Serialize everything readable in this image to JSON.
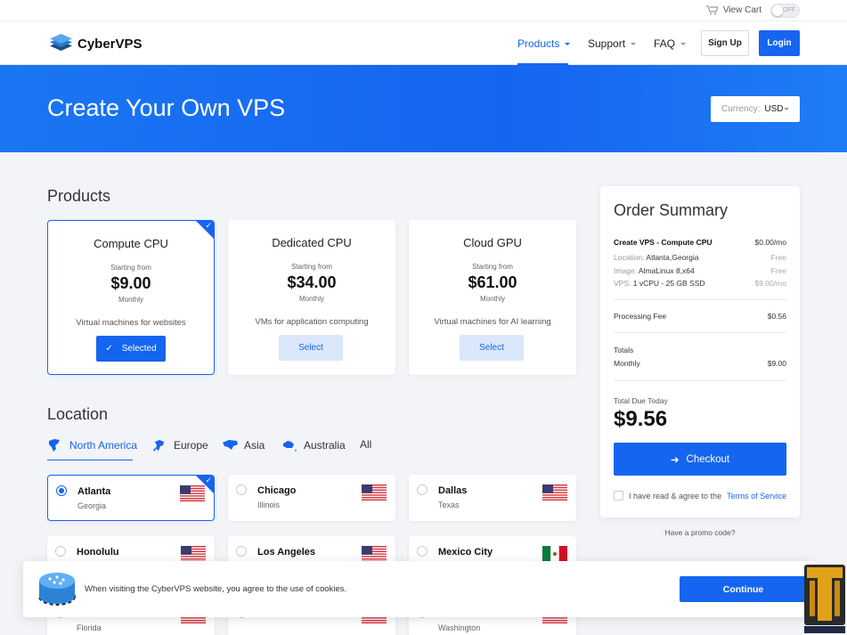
{
  "topbar": {
    "cart_label": "View Cart",
    "toggle_label": "OFF"
  },
  "nav": {
    "brand": "CyberVPS",
    "items": [
      {
        "label": "Products",
        "active": true
      },
      {
        "label": "Support",
        "active": false
      },
      {
        "label": "FAQ",
        "active": false
      }
    ],
    "signup_label": "Sign Up",
    "login_label": "Login"
  },
  "hero": {
    "title": "Create Your Own VPS",
    "currency_label": "Currency:",
    "currency_value": "USD"
  },
  "products": {
    "title": "Products",
    "cards": [
      {
        "name": "Compute CPU",
        "from": "Starting from",
        "price": "$9.00",
        "period": "Monthly",
        "desc": "Virtual machines for websites",
        "button": "Selected",
        "selected": true
      },
      {
        "name": "Dedicated CPU",
        "from": "Starting from",
        "price": "$34.00",
        "period": "Monthly",
        "desc": "VMs for application computing",
        "button": "Select",
        "selected": false
      },
      {
        "name": "Cloud GPU",
        "from": "Starting from",
        "price": "$61.00",
        "period": "Monthly",
        "desc": "Virtual machines for AI learning",
        "button": "Select",
        "selected": false
      }
    ]
  },
  "location": {
    "title": "Location",
    "tabs": [
      {
        "label": "North America",
        "icon": "north-america-icon",
        "active": true
      },
      {
        "label": "Europe",
        "icon": "europe-icon",
        "active": false
      },
      {
        "label": "Asia",
        "icon": "asia-icon",
        "active": false
      },
      {
        "label": "Australia",
        "icon": "australia-icon",
        "active": false
      },
      {
        "label": "All",
        "active": false
      }
    ],
    "cards": [
      {
        "city": "Atlanta",
        "state": "Georgia",
        "flag": "us-flag-icon",
        "selected": true
      },
      {
        "city": "Chicago",
        "state": "Illinois",
        "flag": "us-flag-icon",
        "selected": false
      },
      {
        "city": "Dallas",
        "state": "Texas",
        "flag": "us-flag-icon",
        "selected": false
      },
      {
        "city": "Honolulu",
        "state": "",
        "flag": "us-flag-icon",
        "selected": false
      },
      {
        "city": "Los Angeles",
        "state": "",
        "flag": "us-flag-icon",
        "selected": false
      },
      {
        "city": "Mexico City",
        "state": "",
        "flag": "mexico-flag-icon",
        "selected": false
      },
      {
        "city": "",
        "state": "Florida",
        "flag": "us-flag-icon",
        "selected": false
      },
      {
        "city": "",
        "state": "",
        "flag": "us-flag-icon",
        "selected": false
      },
      {
        "city": "",
        "state": "Washington",
        "flag": "us-flag-icon",
        "selected": false
      }
    ]
  },
  "summary": {
    "title": "Order Summary",
    "product_line": {
      "label": "Create VPS - Compute CPU",
      "value": "$0.00/mo"
    },
    "location": {
      "label": "Location:",
      "value": "Atlanta,Georgia",
      "price": "Free"
    },
    "image": {
      "label": "Image:",
      "value": "AlmaLinux 8,x64",
      "price": "Free"
    },
    "vps": {
      "label": "VPS:",
      "value": "1 vCPU - 25 GB SSD",
      "price": "$9.00/mo"
    },
    "processing_fee": {
      "label": "Processing Fee",
      "value": "$0.56"
    },
    "totals_label": "Totals",
    "monthly": {
      "label": "Monthly",
      "value": "$9.00"
    },
    "due_label": "Total Due Today",
    "due_value": "$9.56",
    "checkout_label": "Checkout",
    "agree_text": "I have read & agree to the",
    "tos_link": "Terms of Service"
  },
  "promo_label": "Have a promo code?",
  "cookie": {
    "text": "When visiting the CyberVPS website, you agree to the use of cookies.",
    "button": "Continue"
  },
  "colors": {
    "accent": "#1565f0",
    "hero": "#1a76f2",
    "background": "#f3f4f7"
  }
}
